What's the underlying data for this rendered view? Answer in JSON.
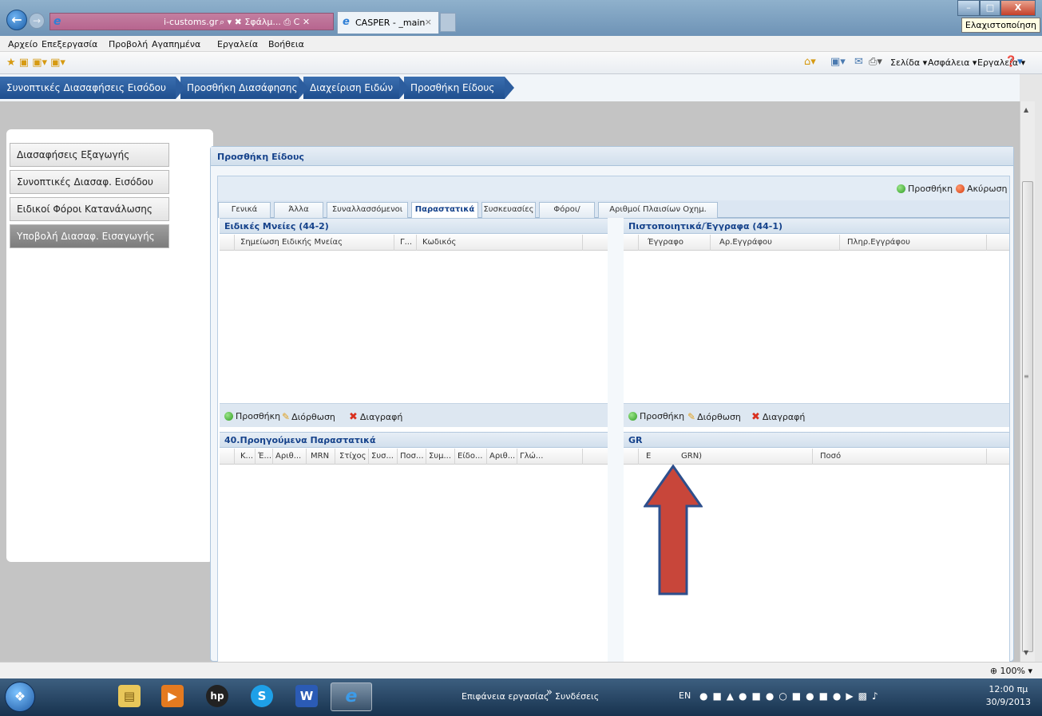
{
  "browser": {
    "address_url": "i-customs.gr",
    "address_controls": "⌕ ▾ ✖ Σφάλμ... ⎙ C ✕",
    "tab_title": "CASPER - _main",
    "tab_close": "×",
    "minimize_tooltip": "Ελαχιστοποίηση",
    "win_min": "–",
    "win_max": "□",
    "win_close": "X"
  },
  "menubar": [
    "Αρχείο",
    "Επεξεργασία",
    "Προβολή",
    "Αγαπημένα",
    "Εργαλεία",
    "Βοήθεια"
  ],
  "commandbar": {
    "page": "Σελίδα ▾",
    "safety": "Ασφάλεια ▾",
    "tools": "Εργαλεία ▾"
  },
  "breadcrumb": [
    "Συνοπτικές Διασαφήσεις Εισόδου",
    "Προσθήκη Διασάφησης",
    "Διαχείριση Ειδών",
    "Προσθήκη Είδους"
  ],
  "sidebar": [
    "Διασαφήσεις Εξαγωγής",
    "Συνοπτικές Διασαφ. Εισόδου",
    "Ειδικοί Φόροι Κατανάλωσης",
    "Υποβολή Διασαφ. Εισαγωγής"
  ],
  "form": {
    "title": "Προσθήκη Είδους",
    "add": "Προσθήκη",
    "cancel": "Ακύρωση",
    "tabs": [
      "Γενικά Στοιχεία",
      "Άλλα Στοιχεία",
      "Συναλλασσόμενοι",
      "Παραστατικά",
      "Συσκευασίες",
      "Φόροι/Δασμοί",
      "Αριθμοί Πλαισίων Οχημ."
    ],
    "active_tab": "Παραστατικά"
  },
  "panels": {
    "special_mentions": {
      "title": "Ειδικές Μνείες (44-2)",
      "columns": [
        "Σημείωση Ειδικής Μνείας",
        "Γ...",
        "Κωδικός"
      ]
    },
    "certificates": {
      "title": "Πιστοποιητικά/Έγγραφα (44-1)",
      "columns": [
        "Έγγραφο",
        "Αρ.Εγγράφου",
        "Πληρ.Εγγράφου"
      ]
    },
    "previous_docs": {
      "title": "40.Προηγούμενα Παραστατικά",
      "columns": [
        "Κ...",
        "Έ...",
        "Αριθ...",
        "MRN",
        "Στίχος",
        "Συσ...",
        "Ποσ...",
        "Συμ...",
        "Είδο...",
        "Αριθ...",
        "Γλώ..."
      ]
    },
    "grn": {
      "title": "GR",
      "columns": [
        "E",
        "GRN)",
        "Ποσό"
      ]
    },
    "actions": {
      "add": "Προσθήκη",
      "edit": "Διόρθωση",
      "delete": "Διαγραφή"
    }
  },
  "status": {
    "zoom": "⊕ 100% ▾"
  },
  "taskbar": {
    "desktop": "Επιφάνεια εργασίας",
    "chevron": "»",
    "connections": "Συνδέσεις",
    "lang": "EN",
    "time": "12:00 πμ",
    "date": "30/9/2013"
  },
  "colors": {
    "breadcrumb_bg": "#2c5d9e",
    "header_text": "#15428b",
    "arrow": "#c8463a"
  }
}
